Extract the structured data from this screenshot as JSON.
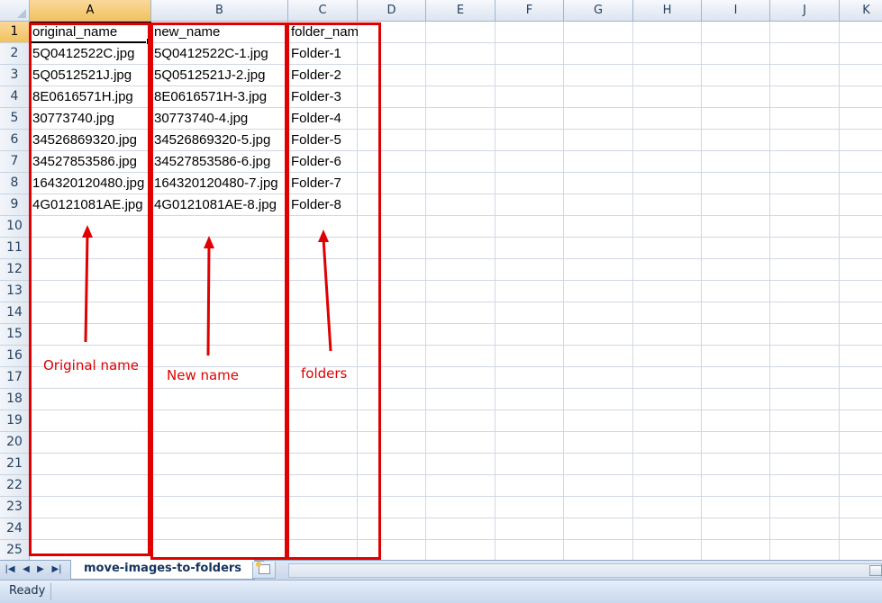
{
  "sheet": {
    "columns": [
      "A",
      "B",
      "C",
      "D",
      "E",
      "F",
      "G",
      "H",
      "I",
      "J",
      "K"
    ],
    "rows": [
      "1",
      "2",
      "3",
      "4",
      "5",
      "6",
      "7",
      "8",
      "9",
      "10",
      "11",
      "12",
      "13",
      "14",
      "15",
      "16",
      "17",
      "18",
      "19",
      "20",
      "21",
      "22",
      "23",
      "24",
      "25"
    ],
    "selected_column": "A",
    "selected_row": "1",
    "cells": {
      "A": [
        "original_name",
        "5Q0412522C.jpg",
        "5Q0512521J.jpg",
        "8E0616571H.jpg",
        "30773740.jpg",
        "34526869320.jpg",
        "34527853586.jpg",
        "164320120480.jpg",
        "4G0121081AE.jpg"
      ],
      "B": [
        "new_name",
        "5Q0412522C-1.jpg",
        "5Q0512521J-2.jpg",
        "8E0616571H-3.jpg",
        "30773740-4.jpg",
        "34526869320-5.jpg",
        "34527853586-6.jpg",
        "164320120480-7.jpg",
        "4G0121081AE-8.jpg"
      ],
      "C": [
        "folder_name",
        "Folder-1",
        "Folder-2",
        "Folder-3",
        "Folder-4",
        "Folder-5",
        "Folder-6",
        "Folder-7",
        "Folder-8"
      ]
    }
  },
  "annotations": {
    "original": "Original name",
    "new": "New name",
    "folders": "folders",
    "color": "#e00000"
  },
  "tabs": {
    "sheet_name": "move-images-to-folders",
    "nav_first_icon": "first-sheet-icon",
    "nav_prev_icon": "prev-sheet-icon",
    "nav_next_icon": "next-sheet-icon",
    "nav_last_icon": "last-sheet-icon",
    "insert_icon": "insert-sheet-icon"
  },
  "status": {
    "text": "Ready"
  }
}
